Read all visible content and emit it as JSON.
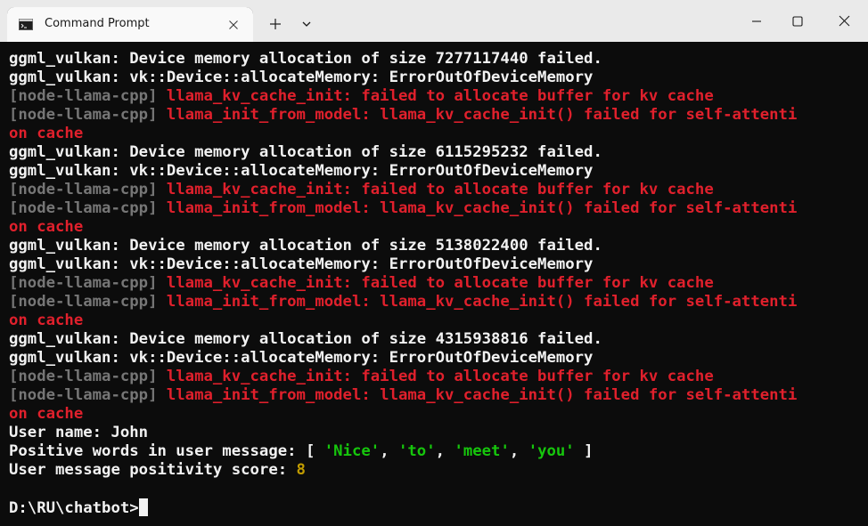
{
  "window": {
    "tab_title": "Command Prompt",
    "tab_icon": "terminal-icon",
    "close_tab_icon": "close-icon",
    "new_tab_icon": "plus-icon",
    "dropdown_icon": "chevron-down-icon",
    "minimize_icon": "minimize-icon",
    "maximize_icon": "maximize-icon",
    "close_window_icon": "close-icon"
  },
  "colors": {
    "background": "#0c0c0c",
    "text": "#f2f2f2",
    "prefix_gray": "#767676",
    "error_red": "#e0202c",
    "string_green": "#16c60c",
    "number_yellow": "#c19c00",
    "titlebar": "#eaeaea"
  },
  "terminal": {
    "blocks": [
      {
        "alloc_line": "ggml_vulkan: Device memory allocation of size 7277117440 failed.",
        "vk_line": "ggml_vulkan: vk::Device::allocateMemory: ErrorOutOfDeviceMemory",
        "kv_prefix": "[node-llama-cpp]",
        "kv_message": " llama_kv_cache_init: failed to allocate buffer for kv cache",
        "init_prefix": "[node-llama-cpp]",
        "init_message": " llama_init_from_model: llama_kv_cache_init() failed for self-attenti",
        "init_wrap": "on cache"
      },
      {
        "alloc_line": "ggml_vulkan: Device memory allocation of size 6115295232 failed.",
        "vk_line": "ggml_vulkan: vk::Device::allocateMemory: ErrorOutOfDeviceMemory",
        "kv_prefix": "[node-llama-cpp]",
        "kv_message": " llama_kv_cache_init: failed to allocate buffer for kv cache",
        "init_prefix": "[node-llama-cpp]",
        "init_message": " llama_init_from_model: llama_kv_cache_init() failed for self-attenti",
        "init_wrap": "on cache"
      },
      {
        "alloc_line": "ggml_vulkan: Device memory allocation of size 5138022400 failed.",
        "vk_line": "ggml_vulkan: vk::Device::allocateMemory: ErrorOutOfDeviceMemory",
        "kv_prefix": "[node-llama-cpp]",
        "kv_message": " llama_kv_cache_init: failed to allocate buffer for kv cache",
        "init_prefix": "[node-llama-cpp]",
        "init_message": " llama_init_from_model: llama_kv_cache_init() failed for self-attenti",
        "init_wrap": "on cache"
      },
      {
        "alloc_line": "ggml_vulkan: Device memory allocation of size 4315938816 failed.",
        "vk_line": "ggml_vulkan: vk::Device::allocateMemory: ErrorOutOfDeviceMemory",
        "kv_prefix": "[node-llama-cpp]",
        "kv_message": " llama_kv_cache_init: failed to allocate buffer for kv cache",
        "init_prefix": "[node-llama-cpp]",
        "init_message": " llama_init_from_model: llama_kv_cache_init() failed for self-attenti",
        "init_wrap": "on cache"
      }
    ],
    "user_name_line": "User name: John",
    "positive_words_label": "Positive words in user message: ",
    "positive_words_open": "[ ",
    "positive_words": [
      "'Nice'",
      "'to'",
      "'meet'",
      "'you'"
    ],
    "positive_words_separator": ", ",
    "positive_words_close": " ]",
    "score_label": "User message positivity score: ",
    "score_value": "8",
    "prompt": "D:\\RU\\chatbot>"
  }
}
